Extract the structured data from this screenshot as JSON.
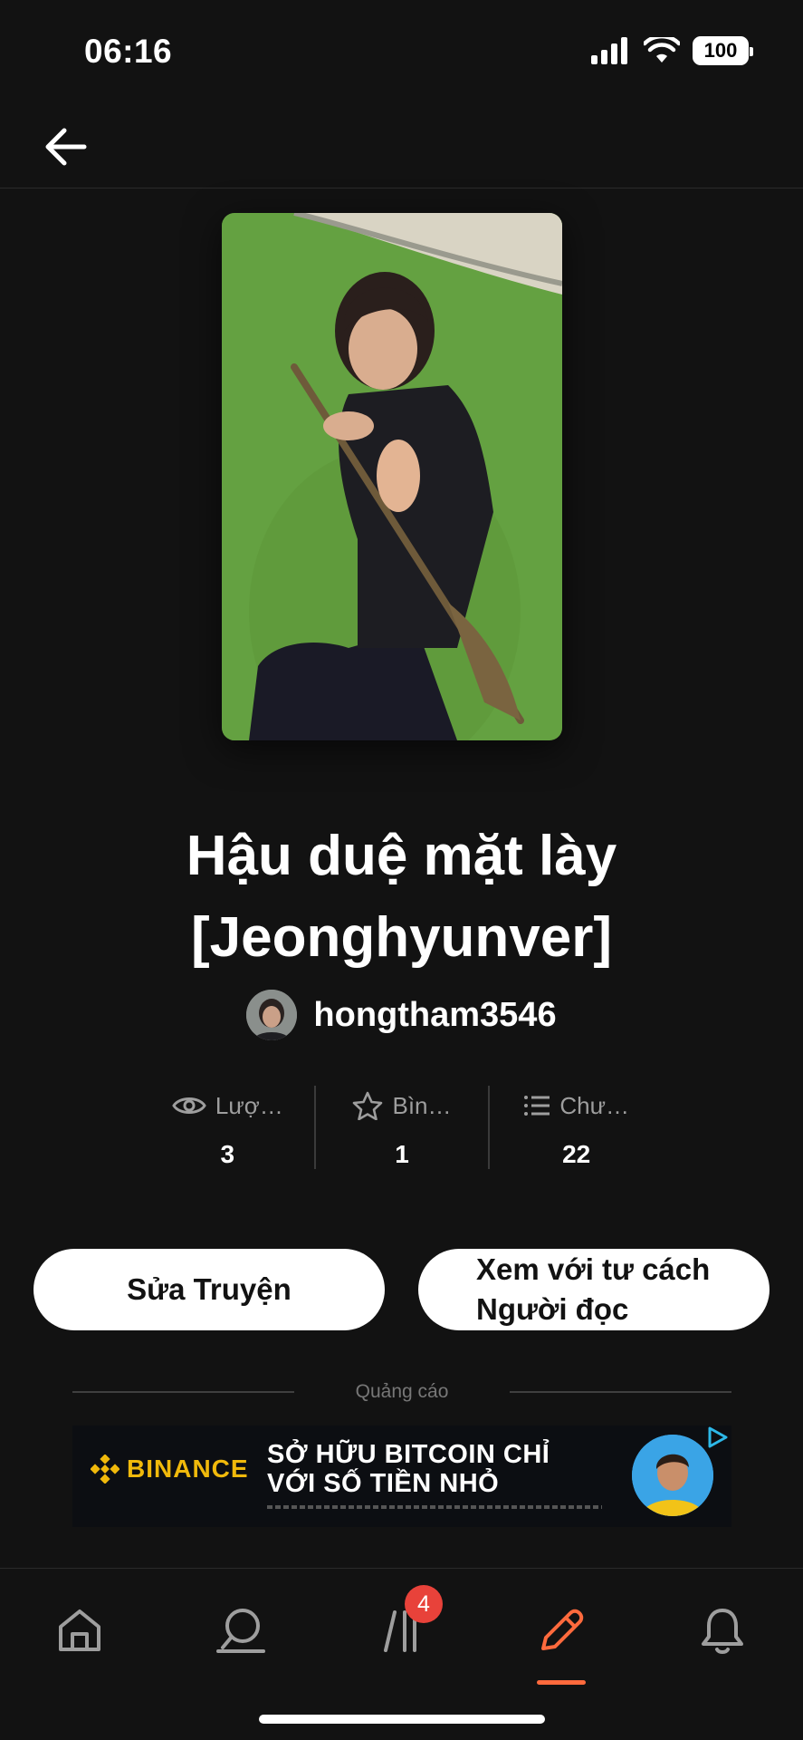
{
  "status_bar": {
    "time": "06:16",
    "battery": "100"
  },
  "story": {
    "title_line1": "Hậu duệ mặt lày",
    "title_line2": "[Jeonghyunver]",
    "author": "hongtham3546"
  },
  "stats": [
    {
      "icon": "eye-icon",
      "label": "Lượ…",
      "value": "3"
    },
    {
      "icon": "star-icon",
      "label": "Bìn…",
      "value": "1"
    },
    {
      "icon": "list-icon",
      "label": "Chư…",
      "value": "22"
    }
  ],
  "buttons": {
    "edit": "Sửa Truyện",
    "reader_line1": "Xem với tư cách",
    "reader_line2": "Người đọc"
  },
  "ad": {
    "label": "Quảng cáo",
    "brand": "BINANCE",
    "text_line1": "SỞ HỮU BITCOIN CHỈ",
    "text_line2": "VỚI SỐ TIỀN NHỎ"
  },
  "tab_bar": {
    "library_badge": "4",
    "active_color": "#ff6a3d",
    "badge_color": "#e8423a"
  }
}
